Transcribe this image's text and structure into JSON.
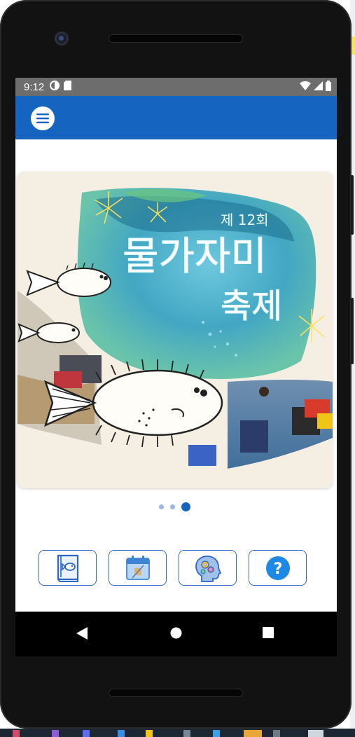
{
  "statusbar": {
    "time": "9:12"
  },
  "banner": {
    "edition": "제 12회",
    "title_line1": "물가자미",
    "title_line2": "축제"
  },
  "carousel": {
    "count": 3,
    "active_index": 2
  },
  "quick_buttons": [
    {
      "icon": "fish-book-icon"
    },
    {
      "icon": "calendar-icon"
    },
    {
      "icon": "head-gears-icon"
    },
    {
      "icon": "help-icon",
      "glyph": "?"
    }
  ],
  "colors": {
    "appbar": "#1565c0",
    "statusbar": "#6d6d6d",
    "accent": "#2c66c6"
  }
}
